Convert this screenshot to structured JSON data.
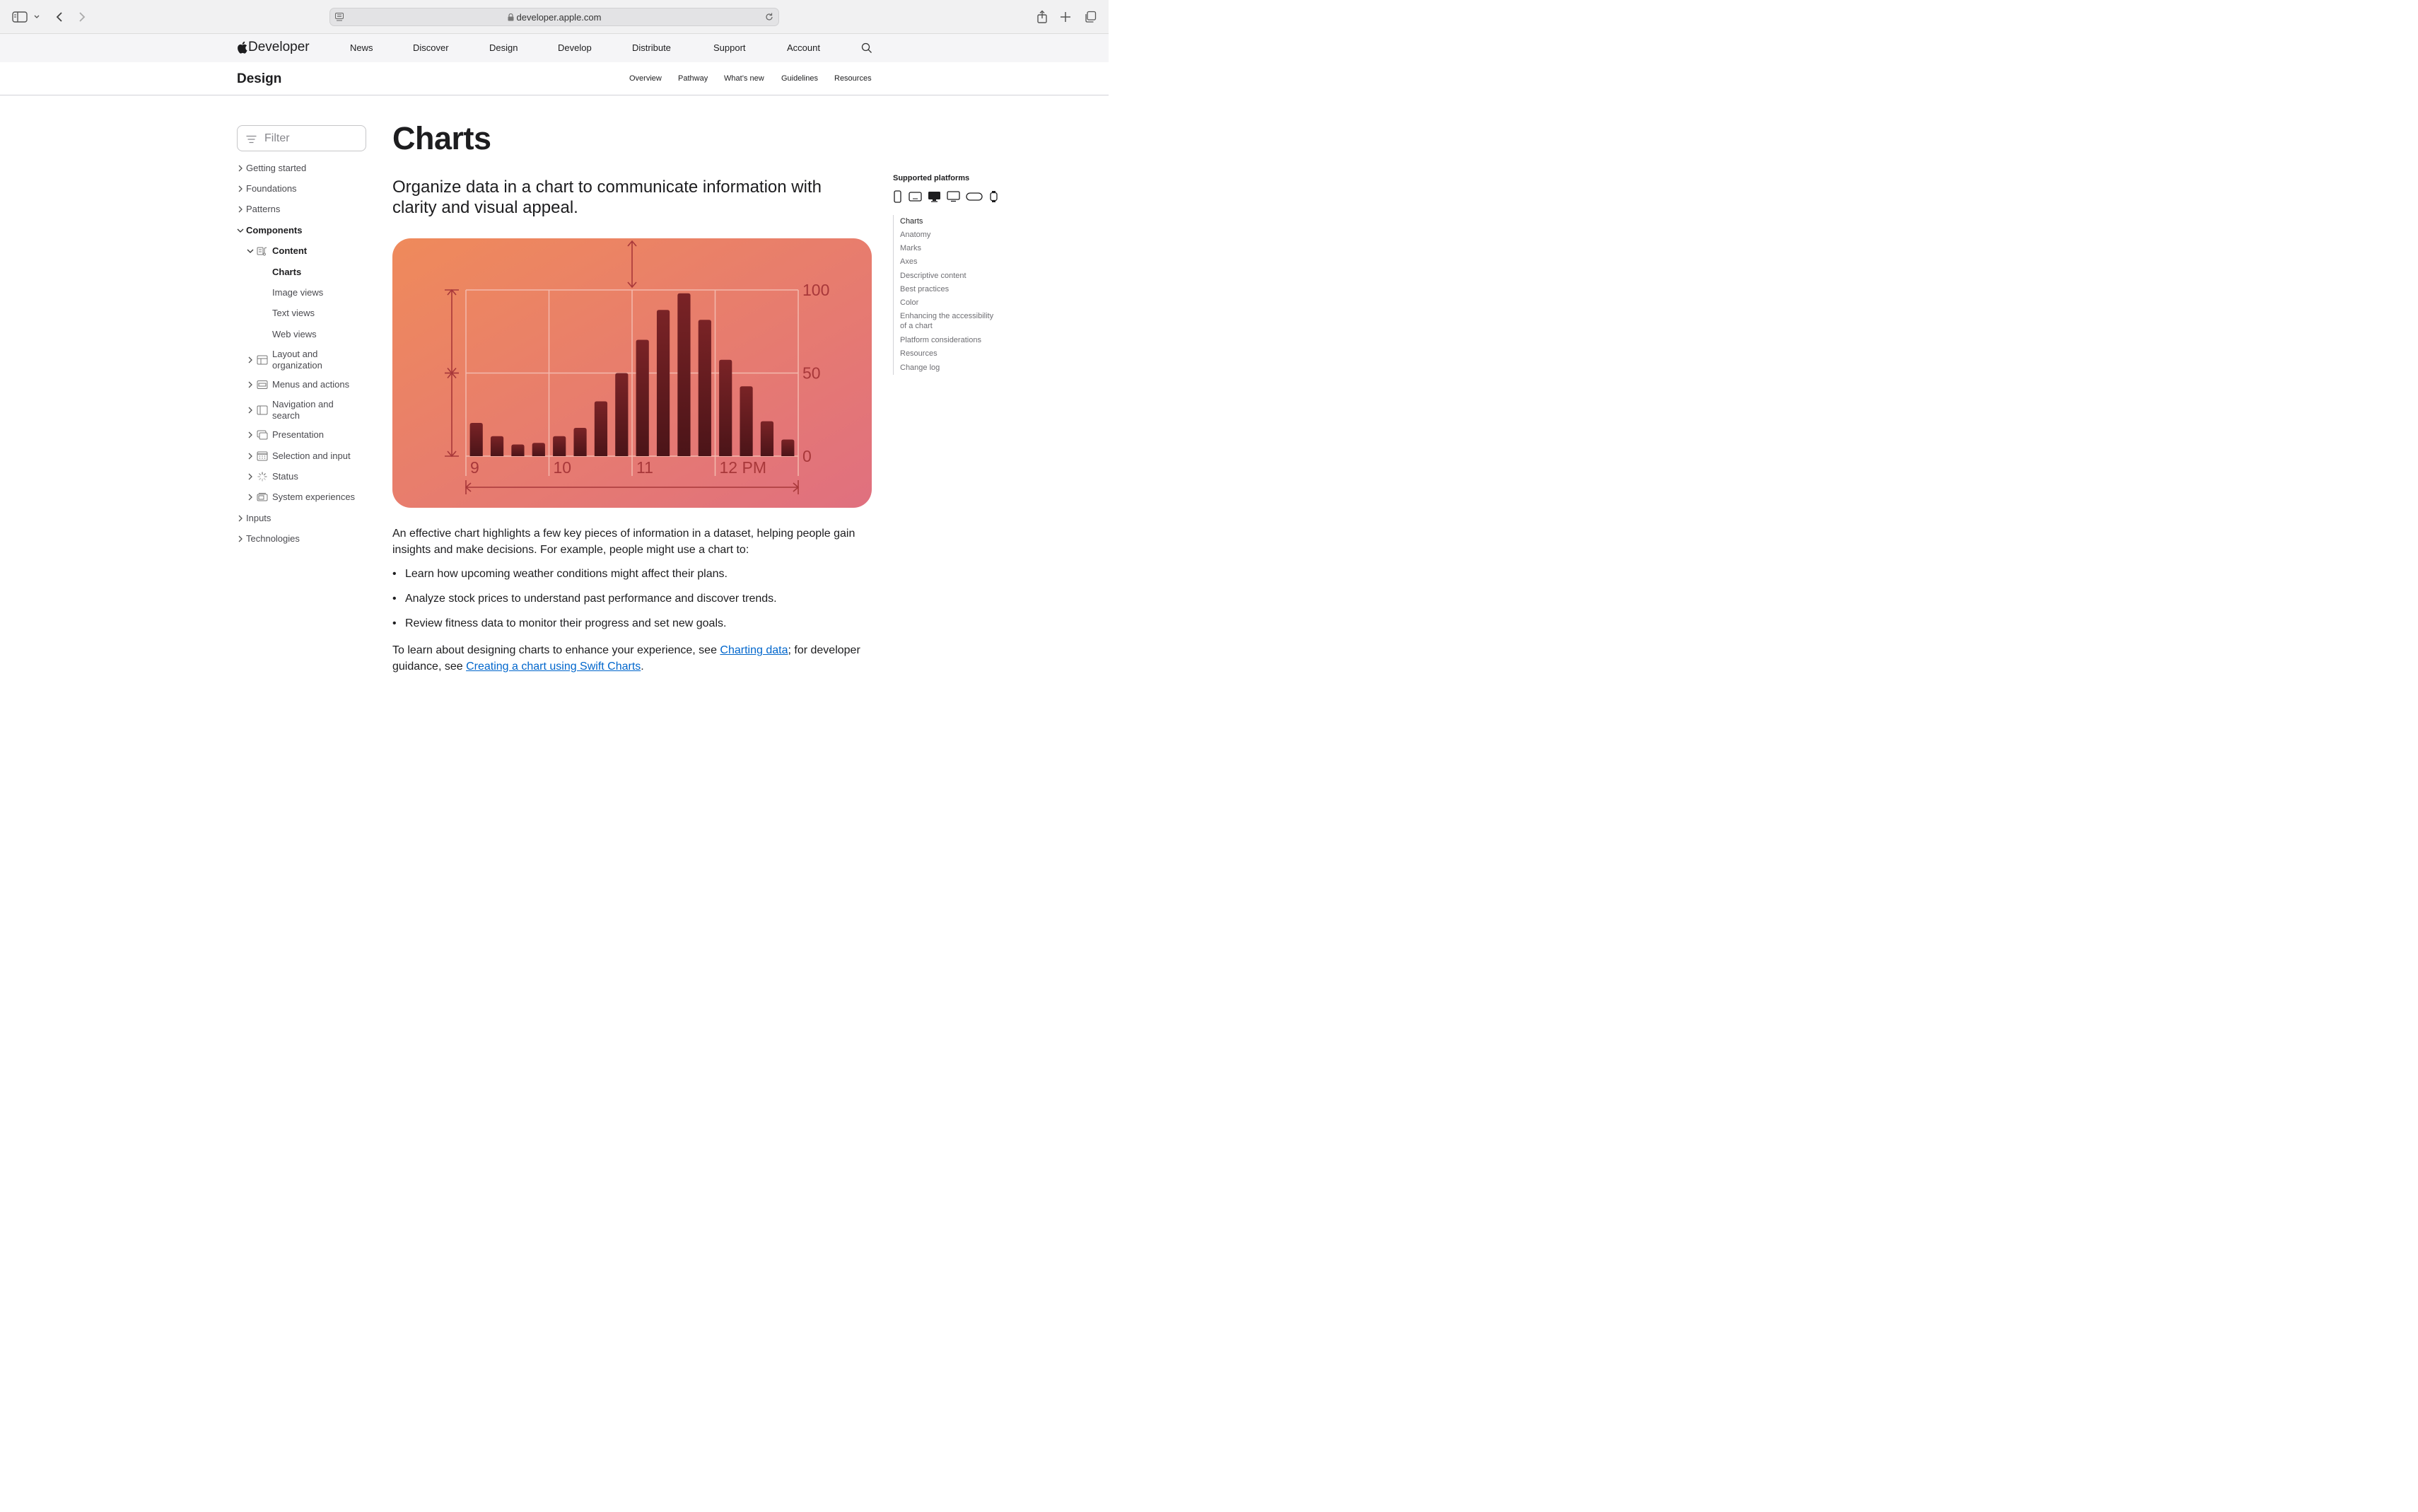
{
  "browser": {
    "url": "developer.apple.com"
  },
  "global_nav": {
    "brand": "Developer",
    "items": [
      "News",
      "Discover",
      "Design",
      "Develop",
      "Distribute",
      "Support",
      "Account"
    ]
  },
  "local_nav": {
    "title": "Design",
    "links": [
      "Overview",
      "Pathway",
      "What’s new",
      "Guidelines",
      "Resources"
    ]
  },
  "sidebar": {
    "filter_placeholder": "Filter",
    "items": [
      {
        "label": "Getting started"
      },
      {
        "label": "Foundations"
      },
      {
        "label": "Patterns"
      },
      {
        "label": "Components"
      },
      {
        "label": "Content"
      },
      {
        "label": "Charts"
      },
      {
        "label": "Image views"
      },
      {
        "label": "Text views"
      },
      {
        "label": "Web views"
      },
      {
        "label": "Layout and",
        "label2": "organization"
      },
      {
        "label": "Menus and actions"
      },
      {
        "label": "Navigation and",
        "label2": "search"
      },
      {
        "label": "Presentation"
      },
      {
        "label": "Selection and input"
      },
      {
        "label": "Status"
      },
      {
        "label": "System experiences"
      },
      {
        "label": "Inputs"
      },
      {
        "label": "Technologies"
      }
    ]
  },
  "main": {
    "title": "Charts",
    "intro": "Organize data in a chart to communicate information with clarity and visual appeal.",
    "paragraph1": "An effective chart highlights a few key pieces of information in a dataset, helping people gain insights and make decisions. For example, people might use a chart to:",
    "bullets": [
      "Learn how upcoming weather conditions might affect their plans.",
      "Analyze stock prices to understand past performance and discover trends.",
      "Review fitness data to monitor their progress and set new goals."
    ],
    "paragraph2_a": "To learn about designing charts to enhance your experience, see ",
    "paragraph2_link1": "Charting data",
    "paragraph2_b": "; for developer guidance, see ",
    "paragraph2_link2": "Creating a chart using Swift Charts",
    "paragraph2_c": "."
  },
  "aside": {
    "platforms_title": "Supported platforms",
    "platform_icons": [
      "iphone-icon",
      "ipad-icon",
      "mac-icon",
      "tv-icon",
      "vision-pro-icon",
      "watch-icon"
    ],
    "toc": [
      {
        "label": "Charts"
      },
      {
        "label": "Anatomy"
      },
      {
        "label": "Marks"
      },
      {
        "label": "Axes"
      },
      {
        "label": "Descriptive content"
      },
      {
        "label": "Best practices"
      },
      {
        "label": "Color"
      },
      {
        "label": "Enhancing the accessibility",
        "label2": "of a chart"
      },
      {
        "label": "Platform considerations"
      },
      {
        "label": "Resources"
      },
      {
        "label": "Change log"
      }
    ]
  },
  "chart_data": {
    "type": "bar",
    "categories": [
      "9",
      "",
      "",
      "",
      "10",
      "",
      "",
      "",
      "11",
      "",
      "",
      "",
      "12 PM",
      "",
      "",
      ""
    ],
    "values": [
      20,
      12,
      7,
      8,
      12,
      17,
      33,
      50,
      70,
      88,
      98,
      82,
      58,
      42,
      21,
      10
    ],
    "ylim": [
      0,
      100
    ],
    "yticks": [
      "0",
      "50",
      "100"
    ],
    "xticks": [
      "9",
      "10",
      "11",
      "12 PM"
    ],
    "colors": {
      "bar_top": "#7a2326",
      "bar_bottom": "#4b1418",
      "grid": "#f3b9ad",
      "dimension": "#a8383a",
      "bg_start": "#ef8a5b",
      "bg_end": "#e0707f"
    }
  }
}
